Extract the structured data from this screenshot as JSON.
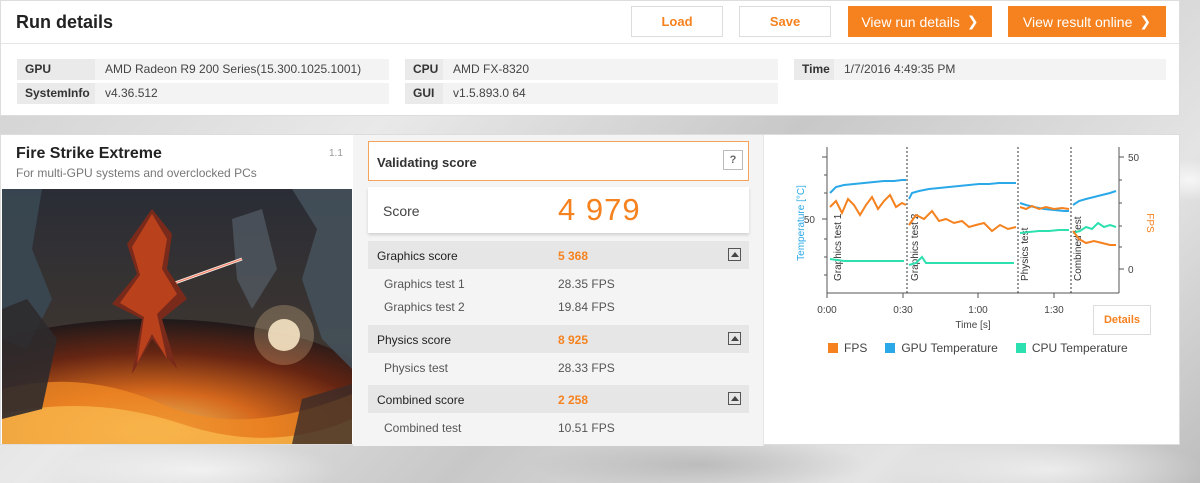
{
  "header": {
    "title": "Run details",
    "load_label": "Load",
    "save_label": "Save",
    "view_run_label": "View run details",
    "view_result_label": "View result online"
  },
  "system_info": {
    "gpu_label": "GPU",
    "gpu_value": "AMD Radeon R9 200 Series(15.300.1025.1001)",
    "systeminfo_label": "SystemInfo",
    "systeminfo_value": "v4.36.512",
    "cpu_label": "CPU",
    "cpu_value": "AMD FX-8320",
    "gui_label": "GUI",
    "gui_value": "v1.5.893.0 64",
    "time_label": "Time",
    "time_value": "1/7/2016 4:49:35 PM"
  },
  "test": {
    "title": "Fire Strike Extreme",
    "subtitle": "For multi-GPU systems and overclocked PCs",
    "version": "1.1"
  },
  "results": {
    "validating_label": "Validating score",
    "help_label": "?",
    "score_label": "Score",
    "score_value": "4 979",
    "graphics_label": "Graphics score",
    "graphics_value": "5 368",
    "graphics_test1_label": "Graphics test 1",
    "graphics_test1_value": "28.35 FPS",
    "graphics_test2_label": "Graphics test 2",
    "graphics_test2_value": "19.84 FPS",
    "physics_label": "Physics score",
    "physics_value": "8 925",
    "physics_test_label": "Physics test",
    "physics_test_value": "28.33 FPS",
    "combined_label": "Combined score",
    "combined_value": "2 258",
    "combined_test_label": "Combined test",
    "combined_test_value": "10.51 FPS"
  },
  "chart": {
    "left_axis_label": "Temperature [°C]",
    "right_axis_label": "FPS",
    "x_axis_label": "Time [s]",
    "left_tick": "50",
    "right_ticks": [
      "50",
      "0"
    ],
    "x_ticks": [
      "0:00",
      "0:30",
      "1:00",
      "1:30"
    ],
    "segment_labels": [
      "Graphics test 1",
      "Graphics test 2",
      "Physics test",
      "Combined test"
    ],
    "details_label": "Details",
    "legend": [
      {
        "label": "FPS",
        "color": "#f5821f"
      },
      {
        "label": "GPU Temperature",
        "color": "#2aa8e8"
      },
      {
        "label": "CPU Temperature",
        "color": "#2de0b0"
      }
    ]
  },
  "colors": {
    "accent": "#f5821f",
    "gpu_line": "#2aa8e8",
    "cpu_line": "#2de0b0"
  }
}
